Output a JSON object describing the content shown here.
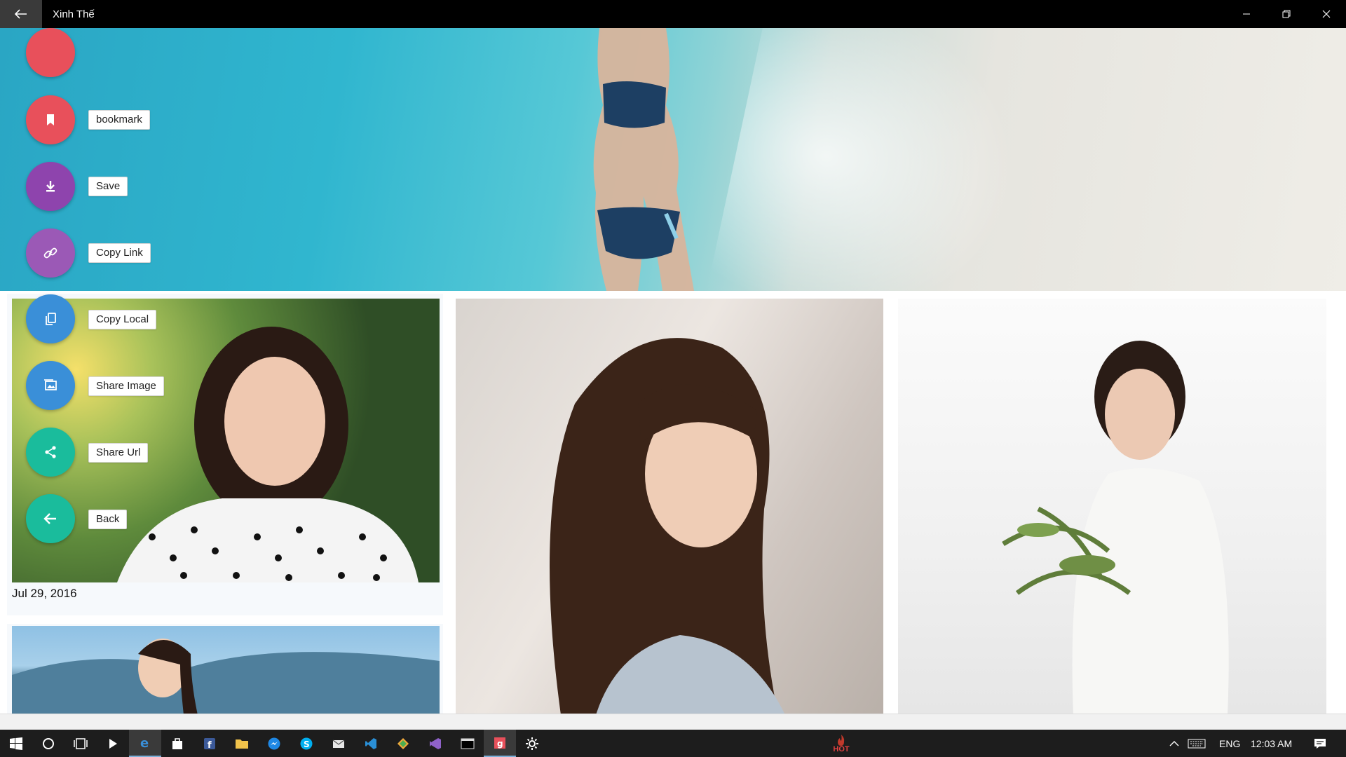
{
  "window": {
    "title": "Xinh Thế"
  },
  "menu": {
    "items": [
      {
        "label": "bookmark",
        "icon": "bookmark-icon",
        "color": "#e8505b"
      },
      {
        "label": "Save",
        "icon": "download-icon",
        "color": "#8e44ad"
      },
      {
        "label": "Copy Link",
        "icon": "link-icon",
        "color": "#9b59b6"
      },
      {
        "label": "Copy Local",
        "icon": "copy-icon",
        "color": "#3a8fd8"
      },
      {
        "label": "Share Image",
        "icon": "image-icon",
        "color": "#3a8fd8"
      },
      {
        "label": "Share Url",
        "icon": "share-icon",
        "color": "#1abc9c"
      },
      {
        "label": "Back",
        "icon": "back-arrow-icon",
        "color": "#1abc9c"
      }
    ],
    "top_button_color": "#e8505b"
  },
  "gallery": {
    "cards": [
      {
        "date": "Jul 29, 2016"
      }
    ]
  },
  "taskbar": {
    "hot_label": "HOT",
    "language": "ENG",
    "time": "12:03 AM",
    "active_accent": "#7cb0d8"
  }
}
